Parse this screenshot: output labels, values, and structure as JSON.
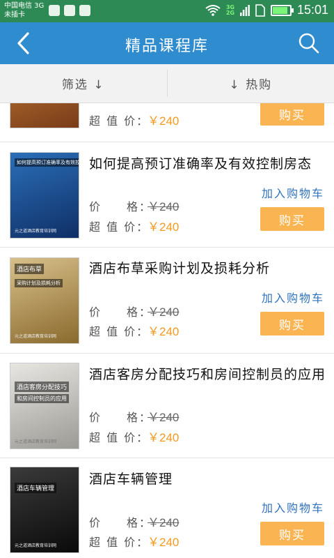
{
  "status_bar": {
    "carrier_line1": "中国电信 3G",
    "carrier_line2": "未插卡",
    "net_3g": "3G",
    "net_2g": "2G",
    "time": "15:01",
    "battery_level": 0.8
  },
  "header": {
    "title": "精品课程库",
    "back_icon": "back-arrow-icon",
    "search_icon": "search-icon"
  },
  "filters": {
    "left": "筛选 ↓",
    "right": "↓ 热购"
  },
  "labels": {
    "price": "价　　格：",
    "sale_price": "超 值 价：",
    "add_to_cart": "加入购物车",
    "buy": "购买"
  },
  "items": [
    {
      "title": "",
      "original_price": "",
      "sale_price": "￥240",
      "thumb_label": "",
      "thumb_caption": "",
      "thumb_colors": [
        "#c8833a",
        "#7a3b18"
      ]
    },
    {
      "title": "如何提高预订准确率及有效控制房态",
      "original_price": "￥240",
      "sale_price": "￥240",
      "thumb_label": "如何提高预订准确率及有效控制房态",
      "thumb_caption": "元之道酒店教育培训网",
      "thumb_colors": [
        "#2b6fb8",
        "#0f2f66"
      ]
    },
    {
      "title": "酒店布草采购计划及损耗分析",
      "original_price": "￥240",
      "sale_price": "￥240",
      "thumb_label": "酒店布草",
      "thumb_sublabel": "采购计划及损耗分析",
      "thumb_caption": "元之道酒店教育培训网",
      "thumb_colors": [
        "#d8c08a",
        "#8a6a2e"
      ]
    },
    {
      "title": "酒店客房分配技巧和房间控制员的应用",
      "original_price": "￥240",
      "sale_price": "￥240",
      "thumb_label": "酒店客房分配技巧",
      "thumb_sublabel": "和房间控制员的应用",
      "thumb_caption": "元之道酒店教育培训网",
      "thumb_colors": [
        "#e8e6e2",
        "#9c9a94"
      ]
    },
    {
      "title": "酒店车辆管理",
      "original_price": "￥240",
      "sale_price": "￥240",
      "thumb_label": "酒店车辆管理",
      "thumb_caption": "元之道酒店教育培训网",
      "thumb_colors": [
        "#3a3a3a",
        "#0a0a0a"
      ]
    }
  ]
}
